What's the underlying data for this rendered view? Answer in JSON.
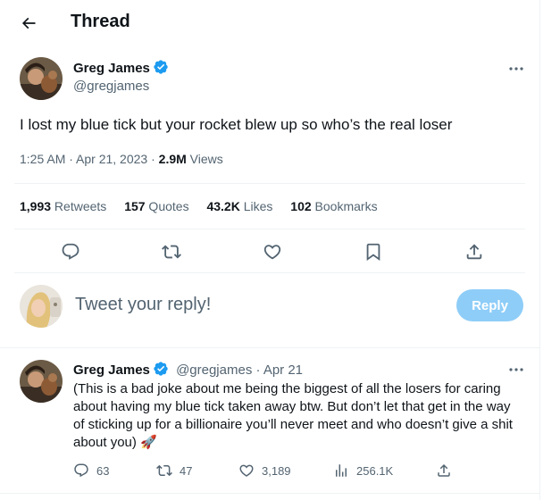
{
  "header": {
    "title": "Thread"
  },
  "tweet": {
    "author_name": "Greg James",
    "author_handle": "@gregjames",
    "text": "I lost my blue tick but your rocket blew up so who’s the real loser",
    "time": "1:25 AM · Apr 21, 2023 · ",
    "views_count": "2.9M",
    "views_label": " Views",
    "stats": {
      "retweets_count": "1,993",
      "retweets_label": " Retweets",
      "quotes_count": "157",
      "quotes_label": " Quotes",
      "likes_count": "43.2K",
      "likes_label": " Likes",
      "bookmarks_count": "102",
      "bookmarks_label": " Bookmarks"
    }
  },
  "composer": {
    "placeholder": "Tweet your reply!",
    "button_label": "Reply"
  },
  "reply": {
    "author_name": "Greg James",
    "author_handle": "@gregjames",
    "date": " · Apr 21",
    "text": "(This is a bad joke about me being the biggest of all the losers for caring about having my blue tick taken away btw. But don’t let that get in the way of sticking up for a billionaire you’ll never meet and who doesn’t give a shit about you) 🚀",
    "replies": "63",
    "retweets": "47",
    "likes": "3,189",
    "views": "256.1K"
  },
  "colors": {
    "accent": "#1d9bf0",
    "reply_button": "#8ecdf8",
    "muted": "#536471",
    "divider": "#eff3f4"
  },
  "icons": [
    "back-arrow-icon",
    "verified-badge-icon",
    "more-icon",
    "reply-icon",
    "retweet-icon",
    "like-icon",
    "bookmark-icon",
    "share-icon",
    "views-icon"
  ]
}
